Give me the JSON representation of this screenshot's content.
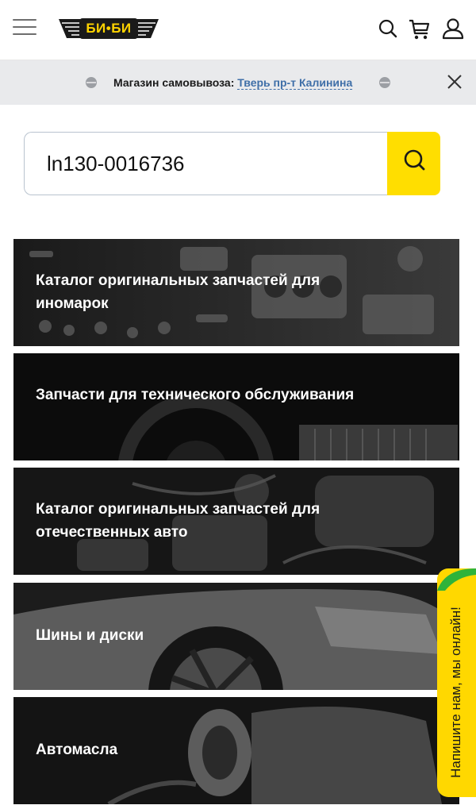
{
  "header": {
    "logo_text": "БИ•БИ",
    "colors": {
      "logo_yellow": "#ffd400",
      "logo_dark": "#1a1a1a"
    }
  },
  "pickup": {
    "label": "Магазин самовывоза: ",
    "store": "Тверь пр-т Калинина",
    "link_color": "#3f6fa8"
  },
  "search": {
    "value": "ln130-0016736",
    "button_color": "#ffde00"
  },
  "categories": [
    {
      "label": "Каталог оригинальных запчастей для иномарок"
    },
    {
      "label": "Запчасти для технического обслуживания"
    },
    {
      "label": "Каталог оригинальных запчастей для отечественных авто"
    },
    {
      "label": "Шины и диски"
    },
    {
      "label": "Автомасла"
    }
  ],
  "chat": {
    "label": "Напишите нам, мы онлайн!",
    "color": "#ffd800",
    "accent": "#2fb33a"
  }
}
